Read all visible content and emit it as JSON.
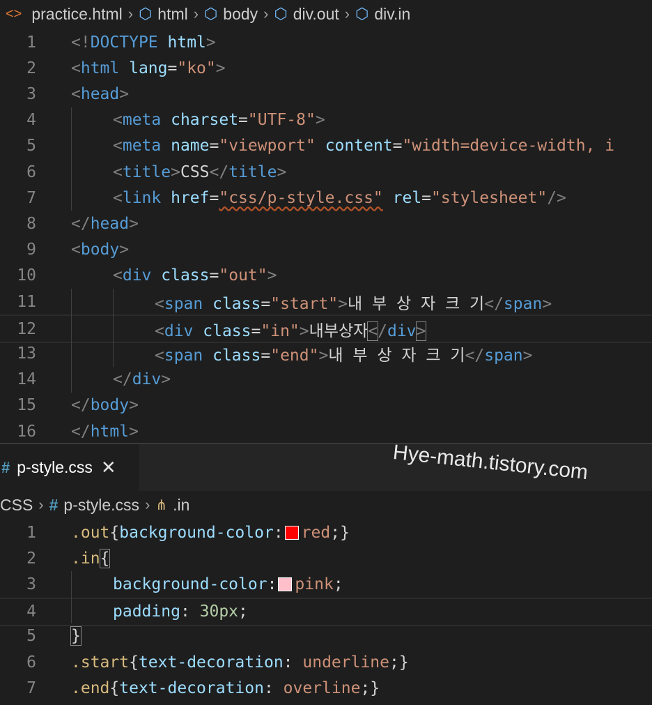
{
  "html_editor": {
    "breadcrumb": {
      "file_icon": "<>",
      "items": [
        "practice.html",
        "html",
        "body",
        "div.out",
        "div.in"
      ]
    },
    "lines": [
      {
        "n": "1",
        "indent": 0,
        "tokens": [
          [
            "pn",
            "<!"
          ],
          [
            "tg",
            "DOCTYPE"
          ],
          [
            "plain",
            " "
          ],
          [
            "an",
            "html"
          ],
          [
            "pn",
            ">"
          ]
        ]
      },
      {
        "n": "2",
        "indent": 0,
        "tokens": [
          [
            "pn",
            "<"
          ],
          [
            "tg",
            "html"
          ],
          [
            "plain",
            " "
          ],
          [
            "an",
            "lang"
          ],
          [
            "plain",
            "="
          ],
          [
            "av",
            "\"ko\""
          ],
          [
            "pn",
            ">"
          ]
        ]
      },
      {
        "n": "3",
        "indent": 0,
        "tokens": [
          [
            "pn",
            "<"
          ],
          [
            "tg",
            "head"
          ],
          [
            "pn",
            ">"
          ]
        ]
      },
      {
        "n": "4",
        "indent": 1,
        "tokens": [
          [
            "pn",
            "<"
          ],
          [
            "tg",
            "meta"
          ],
          [
            "plain",
            " "
          ],
          [
            "an",
            "charset"
          ],
          [
            "plain",
            "="
          ],
          [
            "av",
            "\"UTF-8\""
          ],
          [
            "pn",
            ">"
          ]
        ]
      },
      {
        "n": "5",
        "indent": 1,
        "tokens": [
          [
            "pn",
            "<"
          ],
          [
            "tg",
            "meta"
          ],
          [
            "plain",
            " "
          ],
          [
            "an",
            "name"
          ],
          [
            "plain",
            "="
          ],
          [
            "av",
            "\"viewport\""
          ],
          [
            "plain",
            " "
          ],
          [
            "an",
            "content"
          ],
          [
            "plain",
            "="
          ],
          [
            "av",
            "\"width=device-width, i"
          ]
        ]
      },
      {
        "n": "6",
        "indent": 1,
        "tokens": [
          [
            "pn",
            "<"
          ],
          [
            "tg",
            "title"
          ],
          [
            "pn",
            ">"
          ],
          [
            "plain",
            "CSS"
          ],
          [
            "pn",
            "</"
          ],
          [
            "tg",
            "title"
          ],
          [
            "pn",
            ">"
          ]
        ]
      },
      {
        "n": "7",
        "indent": 1,
        "tokens": [
          [
            "pn",
            "<"
          ],
          [
            "tg",
            "link"
          ],
          [
            "plain",
            " "
          ],
          [
            "an",
            "href"
          ],
          [
            "plain",
            "="
          ],
          [
            "av-sq",
            "\"css/p-style.css\""
          ],
          [
            "plain",
            " "
          ],
          [
            "an",
            "rel"
          ],
          [
            "plain",
            "="
          ],
          [
            "av",
            "\"stylesheet\""
          ],
          [
            "pn",
            "/>"
          ]
        ]
      },
      {
        "n": "8",
        "indent": 0,
        "tokens": [
          [
            "pn",
            "</"
          ],
          [
            "tg",
            "head"
          ],
          [
            "pn",
            ">"
          ]
        ]
      },
      {
        "n": "9",
        "indent": 0,
        "tokens": [
          [
            "pn",
            "<"
          ],
          [
            "tg",
            "body"
          ],
          [
            "pn",
            ">"
          ]
        ]
      },
      {
        "n": "10",
        "indent": 1,
        "tokens": [
          [
            "pn",
            "<"
          ],
          [
            "tg",
            "div"
          ],
          [
            "plain",
            " "
          ],
          [
            "an",
            "class"
          ],
          [
            "plain",
            "="
          ],
          [
            "av",
            "\"out\""
          ],
          [
            "pn",
            ">"
          ]
        ]
      },
      {
        "n": "11",
        "indent": 2,
        "tokens": [
          [
            "pn",
            "<"
          ],
          [
            "tg",
            "span"
          ],
          [
            "plain",
            " "
          ],
          [
            "an",
            "class"
          ],
          [
            "plain",
            "="
          ],
          [
            "av",
            "\"start\""
          ],
          [
            "pn",
            ">"
          ],
          [
            "plain",
            "내 부 상 자 크 기"
          ],
          [
            "pn",
            "</"
          ],
          [
            "tg",
            "span"
          ],
          [
            "pn",
            ">"
          ]
        ]
      },
      {
        "n": "12",
        "indent": 2,
        "tokens": [
          [
            "pn",
            "<"
          ],
          [
            "tg",
            "div"
          ],
          [
            "plain",
            " "
          ],
          [
            "an",
            "class"
          ],
          [
            "plain",
            "="
          ],
          [
            "av",
            "\"in\""
          ],
          [
            "pn",
            ">"
          ],
          [
            "plain",
            "내부상자"
          ],
          [
            "pn-box",
            "<"
          ],
          [
            "pn",
            "/"
          ],
          [
            "tg",
            "div"
          ],
          [
            "pn-box",
            ">"
          ]
        ]
      },
      {
        "n": "13",
        "indent": 2,
        "tokens": [
          [
            "pn",
            "<"
          ],
          [
            "tg",
            "span"
          ],
          [
            "plain",
            " "
          ],
          [
            "an",
            "class"
          ],
          [
            "plain",
            "="
          ],
          [
            "av",
            "\"end\""
          ],
          [
            "pn",
            ">"
          ],
          [
            "plain",
            "내 부 상 자 크 기"
          ],
          [
            "pn",
            "</"
          ],
          [
            "tg",
            "span"
          ],
          [
            "pn",
            ">"
          ]
        ]
      },
      {
        "n": "14",
        "indent": 1,
        "tokens": [
          [
            "pn",
            "</"
          ],
          [
            "tg",
            "div"
          ],
          [
            "pn",
            ">"
          ]
        ]
      },
      {
        "n": "15",
        "indent": 0,
        "tokens": [
          [
            "pn",
            "</"
          ],
          [
            "tg",
            "body"
          ],
          [
            "pn",
            ">"
          ]
        ]
      },
      {
        "n": "16",
        "indent": 0,
        "tokens": [
          [
            "pn",
            "</"
          ],
          [
            "tg",
            "html"
          ],
          [
            "pn",
            ">"
          ]
        ]
      }
    ]
  },
  "css_editor": {
    "tab": {
      "icon": "#",
      "label": "p-style.css",
      "close": "✕"
    },
    "watermark": "Hye-math.tistory.com",
    "breadcrumb": {
      "items": [
        "CSS",
        "p-style.css",
        ".in"
      ]
    },
    "lines": [
      {
        "n": "1",
        "indent": 0,
        "tokens": [
          [
            "sel",
            ".out"
          ],
          [
            "plain",
            "{"
          ],
          [
            "pr",
            "background-color"
          ],
          [
            "plain",
            ":"
          ],
          [
            "swatch",
            "#ff0000"
          ],
          [
            "vl",
            "red"
          ],
          [
            "plain",
            ";}"
          ]
        ]
      },
      {
        "n": "2",
        "indent": 0,
        "tokens": [
          [
            "sel",
            ".in"
          ],
          [
            "plain-box",
            "{"
          ]
        ]
      },
      {
        "n": "3",
        "indent": 1,
        "tokens": [
          [
            "pr",
            "background-color"
          ],
          [
            "plain",
            ":"
          ],
          [
            "swatch",
            "#ffc0cb"
          ],
          [
            "vl",
            "pink"
          ],
          [
            "plain",
            ";"
          ]
        ]
      },
      {
        "n": "4",
        "indent": 1,
        "tokens": [
          [
            "pr",
            "padding"
          ],
          [
            "plain",
            ": "
          ],
          [
            "nm",
            "30px"
          ],
          [
            "plain",
            ";"
          ]
        ]
      },
      {
        "n": "5",
        "indent": 0,
        "tokens": [
          [
            "plain-box",
            "}"
          ]
        ]
      },
      {
        "n": "6",
        "indent": 0,
        "tokens": [
          [
            "sel",
            ".start"
          ],
          [
            "plain",
            "{"
          ],
          [
            "pr",
            "text-decoration"
          ],
          [
            "plain",
            ": "
          ],
          [
            "vl",
            "underline"
          ],
          [
            "plain",
            ";}"
          ]
        ]
      },
      {
        "n": "7",
        "indent": 0,
        "tokens": [
          [
            "sel",
            ".end"
          ],
          [
            "plain",
            "{"
          ],
          [
            "pr",
            "text-decoration"
          ],
          [
            "plain",
            ": "
          ],
          [
            "vl",
            "overline"
          ],
          [
            "plain",
            ";}"
          ]
        ]
      }
    ]
  }
}
